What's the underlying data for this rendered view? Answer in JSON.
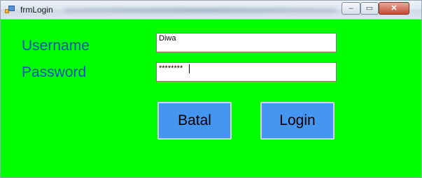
{
  "window": {
    "title": "frmLogin",
    "icon": "winforms-app-icon"
  },
  "window_controls": {
    "minimize": "–",
    "maximize": "▭",
    "close": "✕"
  },
  "form": {
    "background": "#00ff00",
    "username_label": "Username",
    "password_label": "Password",
    "username_value": "Diwa",
    "password_value": "********",
    "cancel_button": "Batal",
    "login_button": "Login"
  },
  "colors": {
    "label": "#1a4dc4",
    "button_bg": "#4596f0"
  }
}
